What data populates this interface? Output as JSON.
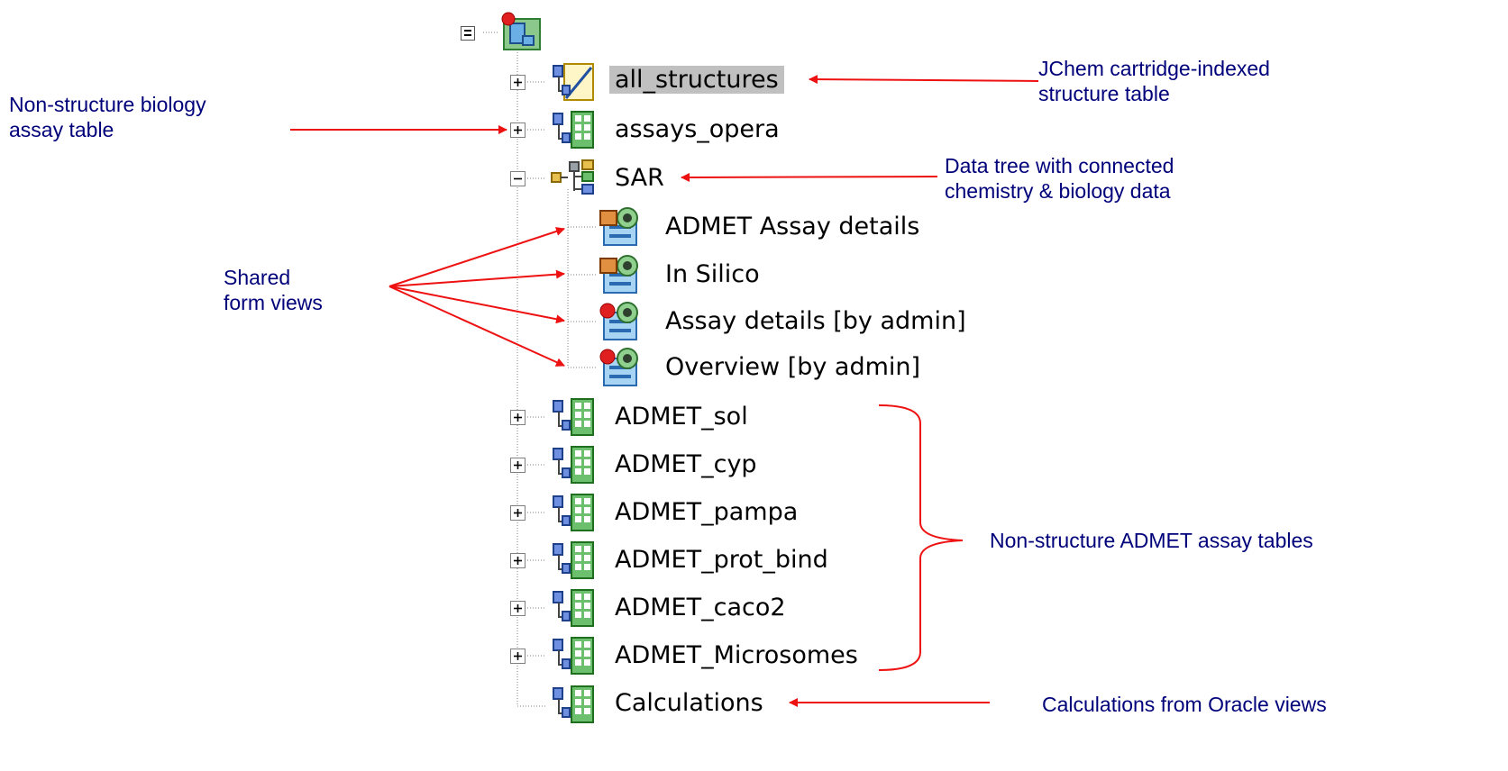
{
  "tree": {
    "tables": [
      {
        "label": "all_structures",
        "selected": true,
        "expander": "+",
        "icon": "structure-table-icon"
      },
      {
        "label": "assays_opera",
        "expander": "+",
        "icon": "data-table-icon"
      },
      {
        "label": "SAR",
        "expander": "-",
        "icon": "data-tree-icon",
        "forms": [
          {
            "label": "ADMET Assay details",
            "icon": "shared-form-view-icon"
          },
          {
            "label": "In Silico",
            "icon": "shared-form-view-icon"
          },
          {
            "label": "Assay details [by admin]",
            "icon": "user-form-view-icon"
          },
          {
            "label": "Overview [by admin]",
            "icon": "user-form-view-icon"
          }
        ]
      },
      {
        "label": "ADMET_sol",
        "expander": "+",
        "icon": "data-table-icon"
      },
      {
        "label": "ADMET_cyp",
        "expander": "+",
        "icon": "data-table-icon"
      },
      {
        "label": "ADMET_pampa",
        "expander": "+",
        "icon": "data-table-icon"
      },
      {
        "label": "ADMET_prot_bind",
        "expander": "+",
        "icon": "data-table-icon"
      },
      {
        "label": "ADMET_caco2",
        "expander": "+",
        "icon": "data-table-icon"
      },
      {
        "label": "ADMET_Microsomes",
        "expander": "+",
        "icon": "data-table-icon"
      },
      {
        "label": "Calculations",
        "expander": "",
        "icon": "data-table-icon"
      }
    ]
  },
  "annotations": {
    "jchem": [
      "JChem cartridge-indexed",
      "structure table"
    ],
    "biology": [
      "Non-structure biology",
      "assay table"
    ],
    "datatree": [
      "Data tree with connected",
      "chemistry & biology data"
    ],
    "shared": [
      "Shared",
      "form views"
    ],
    "admet": "Non-structure ADMET assay tables",
    "calc": "Calculations from Oracle views"
  },
  "colors": {
    "arrow": "#ee1111",
    "annotation": "#00007a",
    "selection": "#c0c0c0"
  }
}
